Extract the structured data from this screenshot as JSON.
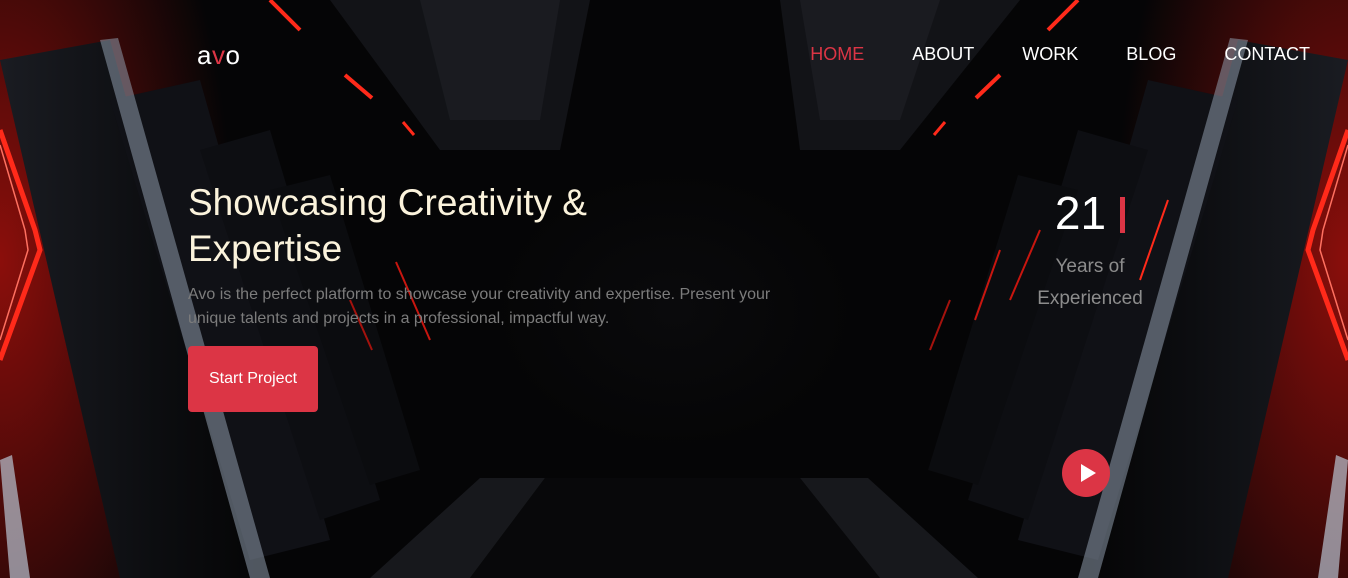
{
  "brand": {
    "logo_prefix": "a",
    "logo_accent": "v",
    "logo_suffix": "o",
    "accent_color": "#dc3545"
  },
  "nav": {
    "items": [
      {
        "label": "HOME",
        "active": true
      },
      {
        "label": "ABOUT",
        "active": false
      },
      {
        "label": "WORK",
        "active": false
      },
      {
        "label": "BLOG",
        "active": false
      },
      {
        "label": "CONTACT",
        "active": false
      }
    ]
  },
  "hero": {
    "title_line1": "Showcasing Creativity &",
    "title_line2": "Expertise",
    "description": "Avo is the perfect platform to showcase your creativity and expertise. Present your unique talents and projects in a professional, impactful way.",
    "cta_label": "Start Project"
  },
  "stats": {
    "years_value": "21",
    "years_label_line1": "Years of",
    "years_label_line2": "Experienced"
  },
  "icons": {
    "play": "play-icon"
  }
}
